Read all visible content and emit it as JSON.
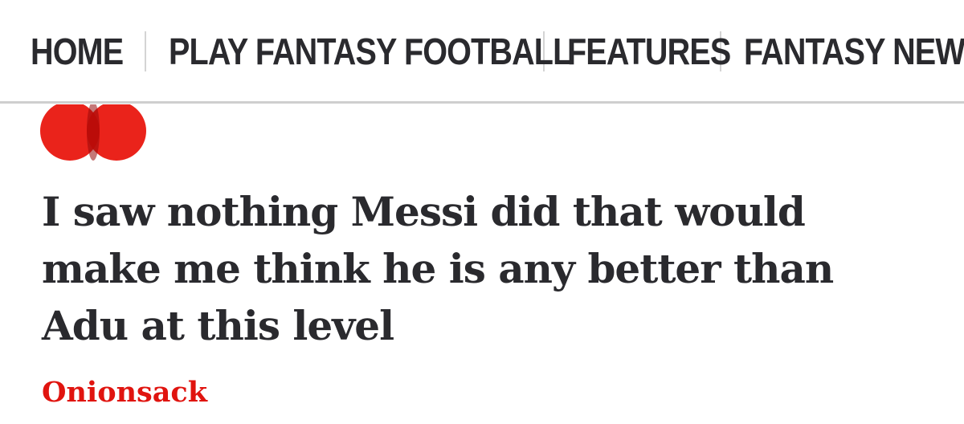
{
  "nav": {
    "items": [
      {
        "label": "HOME"
      },
      {
        "label": "PLAY FANTASY FOOTBALL"
      },
      {
        "label": "FEATURES"
      },
      {
        "label": "FANTASY NEWS"
      }
    ]
  },
  "article": {
    "headline": "I saw nothing Messi did that would make me think he is any better than Adu at this level",
    "author": "Onionsack"
  },
  "colors": {
    "accent": "#e0140f",
    "text": "#2a2a2e",
    "divider": "#cfcfcf"
  }
}
